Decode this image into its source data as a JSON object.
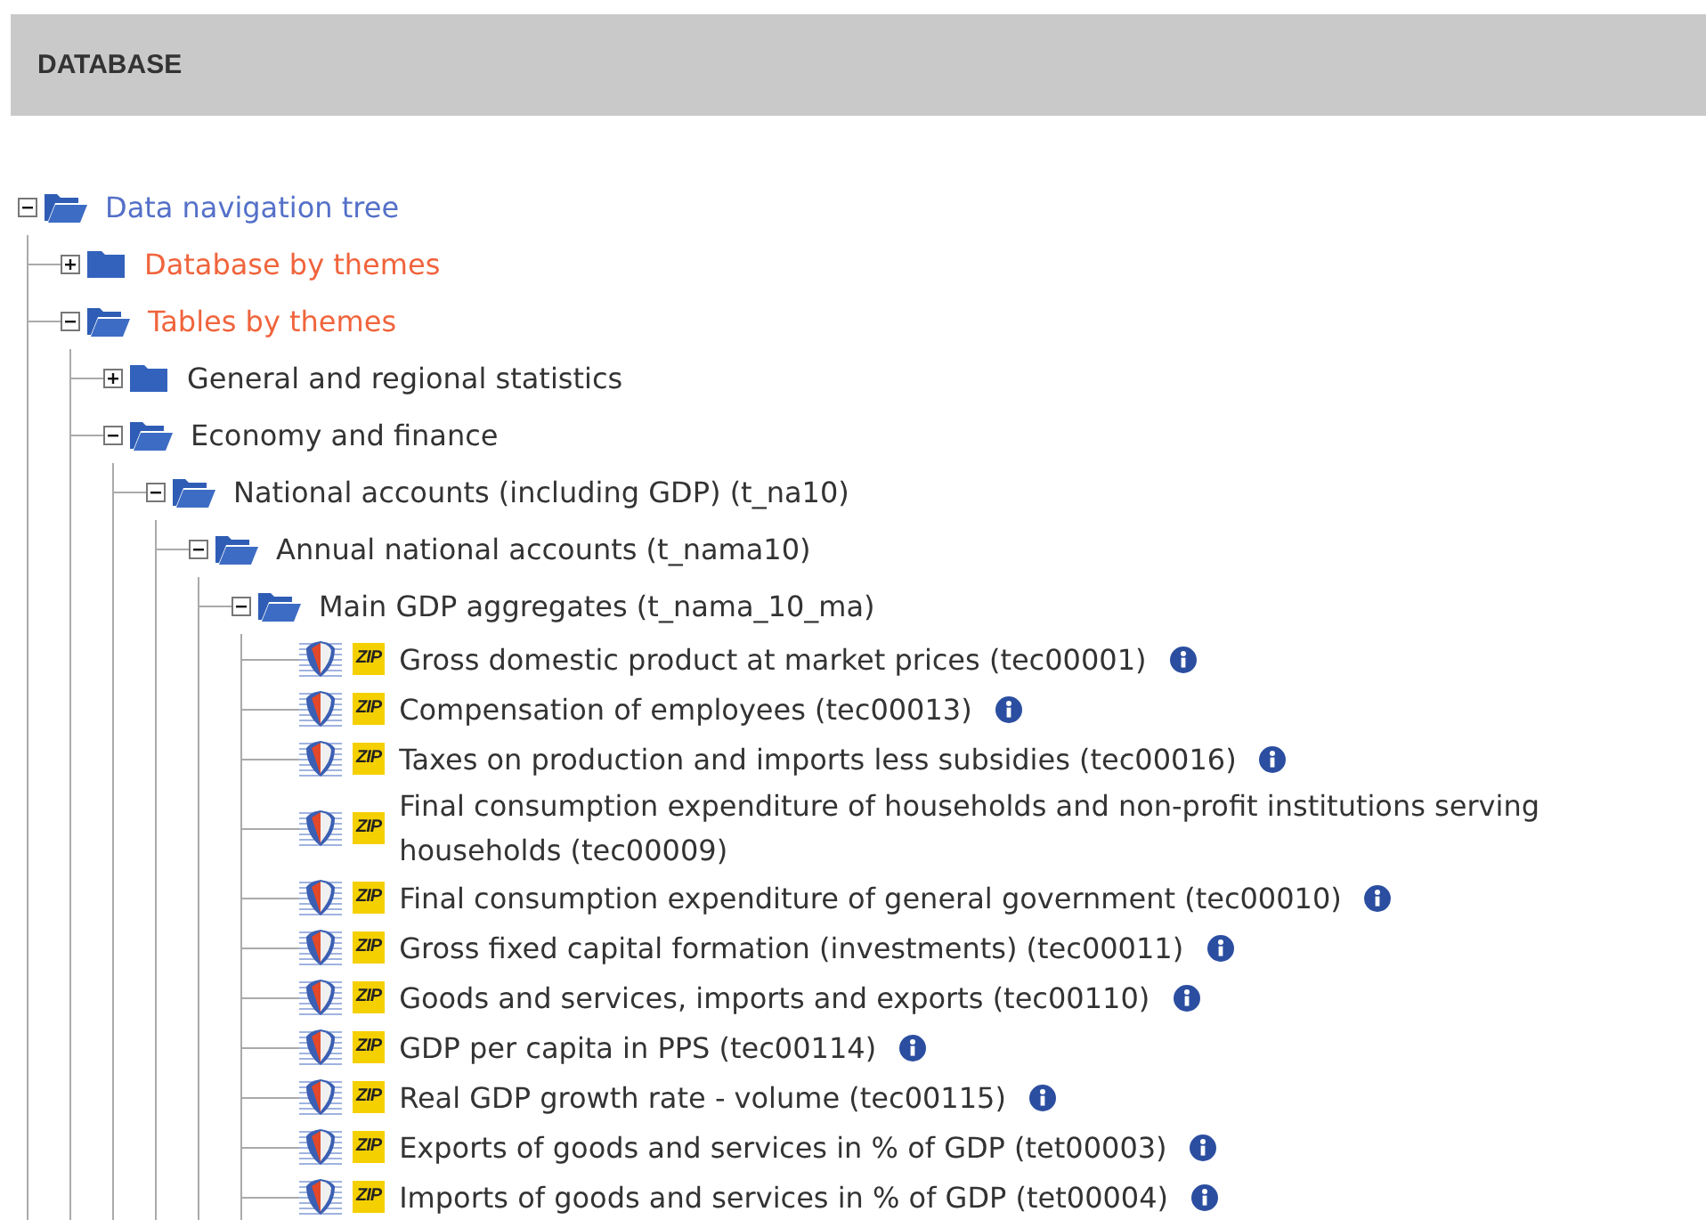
{
  "header": {
    "title": "DATABASE"
  },
  "tree": [
    {
      "kind": "folder",
      "label": "Data navigation tree",
      "expanded": true,
      "color": "#5470c8",
      "children": [
        {
          "kind": "folder",
          "label": "Database by themes",
          "expanded": false,
          "color": "#f0643c"
        },
        {
          "kind": "folder",
          "label": "Tables by themes",
          "expanded": true,
          "color": "#f0643c",
          "children": [
            {
              "kind": "folder",
              "label": "General and regional statistics",
              "expanded": false
            },
            {
              "kind": "folder",
              "label": "Economy and finance",
              "expanded": true,
              "children": [
                {
                  "kind": "folder",
                  "label": "National accounts (including GDP) (t_na10)",
                  "expanded": true,
                  "children": [
                    {
                      "kind": "folder",
                      "label": "Annual national accounts (t_nama10)",
                      "expanded": true,
                      "children": [
                        {
                          "kind": "folder",
                          "label": "Main GDP aggregates (t_nama_10_ma)",
                          "expanded": true,
                          "children": [
                            {
                              "kind": "dataset",
                              "badge": "ZIP",
                              "label": "Gross domestic product at market prices (tec00001)",
                              "info": true
                            },
                            {
                              "kind": "dataset",
                              "badge": "ZIP",
                              "label": "Compensation of employees (tec00013)",
                              "info": true
                            },
                            {
                              "kind": "dataset",
                              "badge": "ZIP",
                              "label": "Taxes on production and imports less subsidies (tec00016)",
                              "info": true
                            },
                            {
                              "kind": "dataset",
                              "badge": "ZIP",
                              "label": "Final consumption expenditure of households and non-profit institutions serving households (tec00009)",
                              "info": false
                            },
                            {
                              "kind": "dataset",
                              "badge": "ZIP",
                              "label": "Final consumption expenditure of general government (tec00010)",
                              "info": true
                            },
                            {
                              "kind": "dataset",
                              "badge": "ZIP",
                              "label": "Gross fixed capital formation (investments) (tec00011)",
                              "info": true
                            },
                            {
                              "kind": "dataset",
                              "badge": "ZIP",
                              "label": "Goods and services, imports and exports (tec00110)",
                              "info": true
                            },
                            {
                              "kind": "dataset",
                              "badge": "ZIP",
                              "label": "GDP per capita in PPS (tec00114)",
                              "info": true
                            },
                            {
                              "kind": "dataset",
                              "badge": "ZIP",
                              "label": "Real GDP growth rate - volume (tec00115)",
                              "info": true
                            },
                            {
                              "kind": "dataset",
                              "badge": "ZIP",
                              "label": "Exports of goods and services in % of GDP (tet00003)",
                              "info": true
                            },
                            {
                              "kind": "dataset",
                              "badge": "ZIP",
                              "label": "Imports of goods and services in % of GDP (tet00004)",
                              "info": true
                            }
                          ]
                        }
                      ]
                    }
                  ]
                }
              ]
            }
          ]
        }
      ]
    }
  ]
}
